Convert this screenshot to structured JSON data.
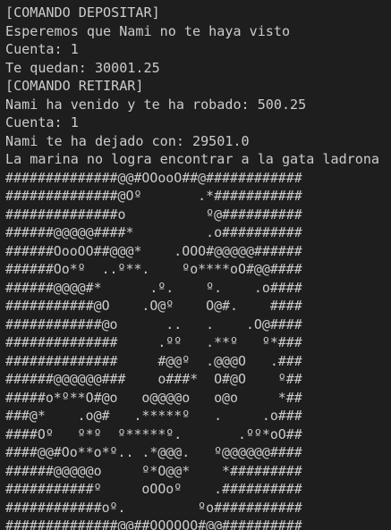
{
  "terminal": {
    "output_lines": [
      "[COMANDO DEPOSITAR]",
      "Esperemos que Nami no te haya visto",
      "Cuenta: 1",
      "Te quedan: 30001.25",
      "[COMANDO RETIRAR]",
      "Nami ha venido y te ha robado: 500.25",
      "Cuenta: 1",
      "Nami te ha dejado con: 29501.0",
      "La marina no logra encontrar a la gata ladrona"
    ],
    "ascii_art": [
      "##############@@#OOooO##@############",
      "##############@Oº       .*###########",
      "##############o          º@##########",
      "######@@@@@####*         .o##########",
      "######OooOO##@@@*    .OOO#@@@@@######",
      "######Oo*º  ..º**.    ºo****oO#@@####",
      "######@@@@#*      .º.    º.    .o####",
      "###########@O    .O@º    O@#.    ####",
      "############@o      ..   .    .O@####",
      "##############     .ºº   .**º   º*###",
      "##############     #@@º  .@@@O   .###",
      "######@@@@@@###    o###*  O#@O    º##",
      "#####o*º**O#@o   o@@@@o   o@o     *##",
      "###@*    .o@#   .*****º   .     .o###",
      "####Oº   º*º  º*****º.       .ºº*oO##",
      "####@@#Oo**o*º.. .*@@@.   º@@@@@@####",
      "######@@@@@o     º*O@@*    *#########",
      "###########º     oOOoº    .##########",
      "############oº.         ºo###########",
      "##############@@##OOOOOO#@@##########"
    ]
  }
}
